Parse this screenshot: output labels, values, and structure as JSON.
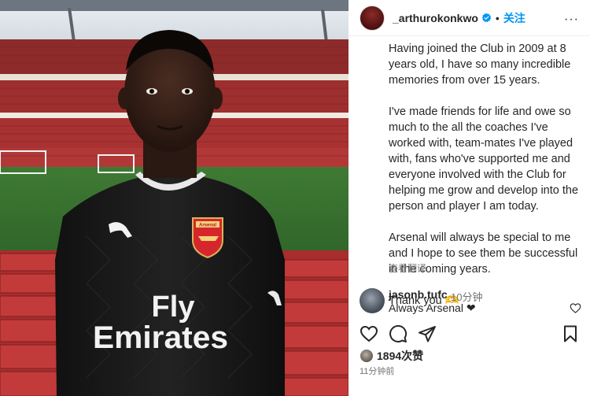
{
  "post": {
    "username": "_arthurokonkwo",
    "separator": "•",
    "follow_label": "关注",
    "more_label": "···"
  },
  "caption": {
    "paragraphs": [
      "Having joined the Club in 2009 at 8 years old, I have so many incredible memories from over 15 years.",
      "I've made friends for life and owe so much to the all the coaches I've worked with, team-mates I've played with, fans who've supported me and everyone involved with the Club for helping me grow and develop into the person and player I am today.",
      "Arsenal will always be special to me and I hope to see them be successful in the coming years.",
      "Thank you 🫶"
    ],
    "translate_label": "查看翻译"
  },
  "comment": {
    "username": "jasonb.tufc",
    "time": "10分钟",
    "text": "Always Arsenal ❤"
  },
  "likes": {
    "count_label": "1894次赞"
  },
  "posted": {
    "time_ago": "11分钟前"
  },
  "photo": {
    "shirt_line1": "Fly",
    "shirt_line2": "Emirates",
    "crest_text": "Arsenal"
  },
  "colors": {
    "accent": "#0095f6",
    "verified": "#0095f6",
    "text_primary": "#262626",
    "text_secondary": "#737373"
  },
  "icons": {
    "like": "heart-icon",
    "comment": "comment-bubble-icon",
    "share": "paper-plane-icon",
    "save": "bookmark-icon",
    "verified": "verified-badge-icon",
    "more": "more-options-icon"
  }
}
